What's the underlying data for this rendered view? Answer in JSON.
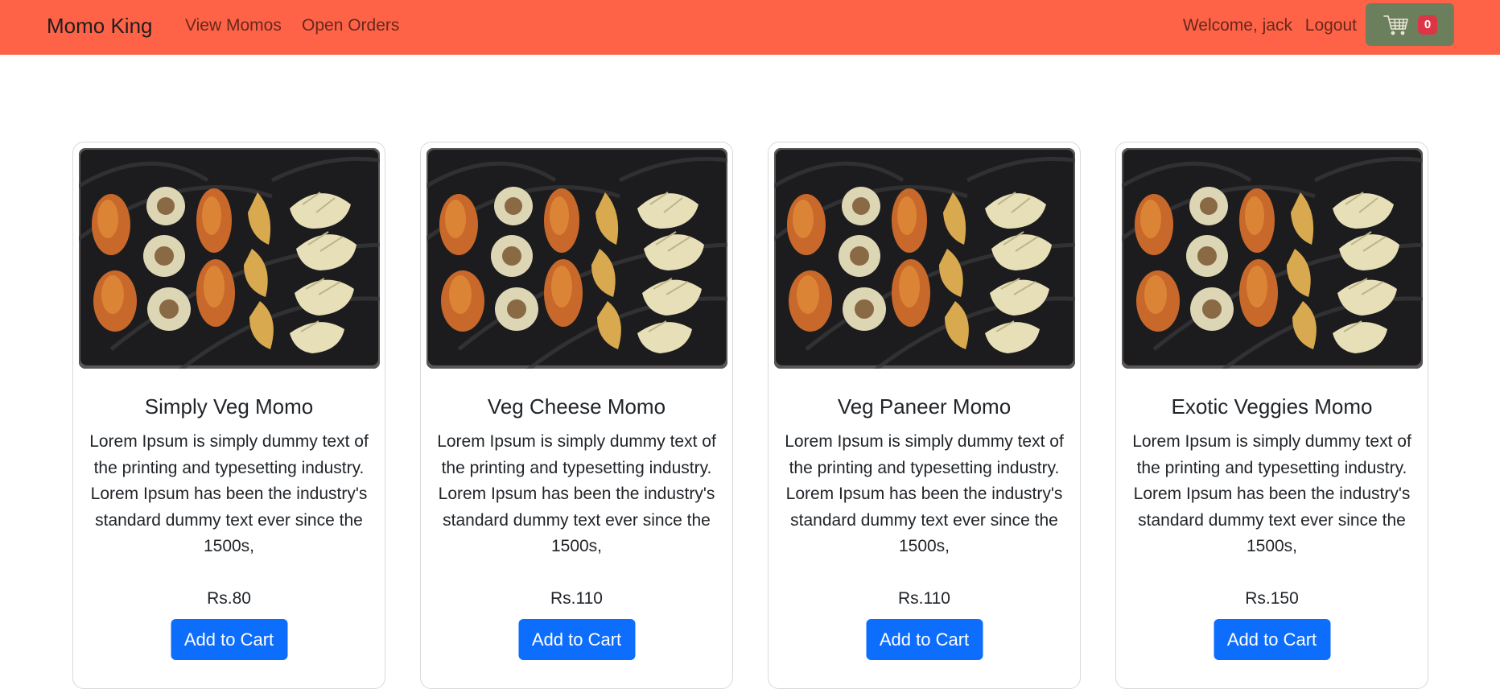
{
  "navbar": {
    "brand": "Momo King",
    "links": [
      {
        "label": "View Momos"
      },
      {
        "label": "Open Orders"
      }
    ],
    "welcome": "Welcome, jack",
    "logout": "Logout",
    "cart_count": "0",
    "cart_icon": "shopping-cart-icon"
  },
  "colors": {
    "navbar_bg": "#ff6347",
    "cart_button_bg": "#6b7f5c",
    "badge_bg": "#dc3545",
    "primary_button": "#0d6efd"
  },
  "products": [
    {
      "name": "Simply Veg Momo",
      "description": "Lorem Ipsum is simply dummy text of the printing and typesetting industry. Lorem Ipsum has been the industry's standard dummy text ever since the 1500s,",
      "price": "Rs.80",
      "button": "Add to Cart"
    },
    {
      "name": "Veg Cheese Momo",
      "description": "Lorem Ipsum is simply dummy text of the printing and typesetting industry. Lorem Ipsum has been the industry's standard dummy text ever since the 1500s,",
      "price": "Rs.110",
      "button": "Add to Cart"
    },
    {
      "name": "Veg Paneer Momo",
      "description": "Lorem Ipsum is simply dummy text of the printing and typesetting industry. Lorem Ipsum has been the industry's standard dummy text ever since the 1500s,",
      "price": "Rs.110",
      "button": "Add to Cart"
    },
    {
      "name": "Exotic Veggies Momo",
      "description": "Lorem Ipsum is simply dummy text of the printing and typesetting industry. Lorem Ipsum has been the industry's standard dummy text ever since the 1500s,",
      "price": "Rs.150",
      "button": "Add to Cart"
    }
  ]
}
